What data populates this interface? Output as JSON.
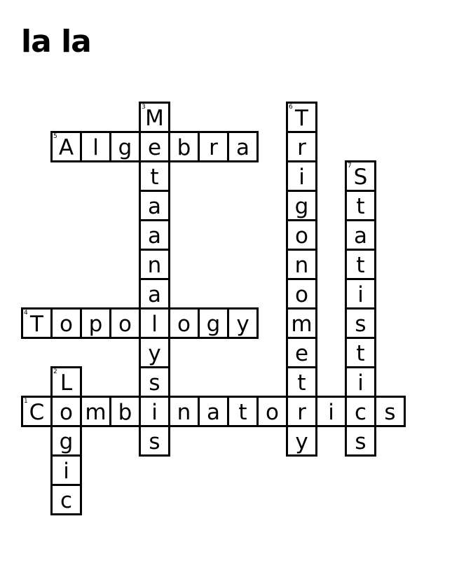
{
  "title": "la la",
  "puzzle": {
    "cols": 13,
    "rows": 14,
    "entries": [
      {
        "number": "1",
        "direction": "across",
        "row": 10,
        "col": 0,
        "answer": "Combinatorics"
      },
      {
        "number": "2",
        "direction": "down",
        "row": 9,
        "col": 1,
        "answer": "Logic"
      },
      {
        "number": "3",
        "direction": "down",
        "row": 0,
        "col": 4,
        "answer": "Metaanalysis"
      },
      {
        "number": "4",
        "direction": "across",
        "row": 7,
        "col": 0,
        "answer": "Topology"
      },
      {
        "number": "5",
        "direction": "across",
        "row": 1,
        "col": 1,
        "answer": "Algebra"
      },
      {
        "number": "6",
        "direction": "down",
        "row": 0,
        "col": 9,
        "answer": "Trigonometry"
      },
      {
        "number": "7",
        "direction": "down",
        "row": 2,
        "col": 11,
        "answer": "Statistics"
      }
    ]
  }
}
